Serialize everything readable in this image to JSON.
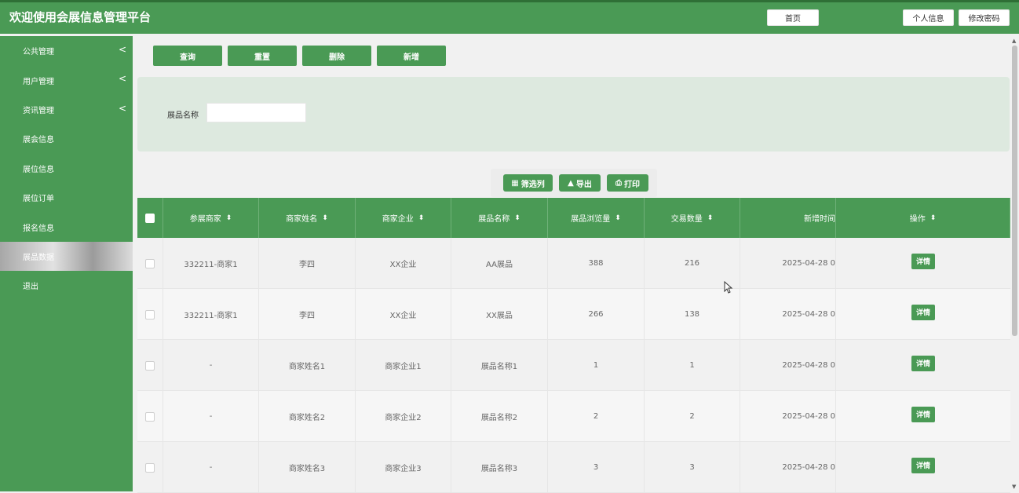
{
  "header": {
    "title": "欢迎使用会展信息管理平台",
    "home_label": "首页",
    "profile_label": "个人信息",
    "password_label": "修改密码"
  },
  "sidebar": {
    "items": [
      {
        "label": "公共管理",
        "has_submenu": true
      },
      {
        "label": "用户管理",
        "has_submenu": true
      },
      {
        "label": "资讯管理",
        "has_submenu": true
      },
      {
        "label": "展会信息",
        "has_submenu": false
      },
      {
        "label": "展位信息",
        "has_submenu": false
      },
      {
        "label": "展位订单",
        "has_submenu": false
      },
      {
        "label": "报名信息",
        "has_submenu": false
      },
      {
        "label": "展品数据",
        "has_submenu": false,
        "active": true
      },
      {
        "label": "退出",
        "has_submenu": false
      }
    ],
    "chevron": "<"
  },
  "actions": {
    "query": "查询",
    "reset": "重置",
    "delete": "删除",
    "add": "新增"
  },
  "search": {
    "label": "展品名称",
    "value": "",
    "placeholder": ""
  },
  "tools": {
    "filter_columns": "筛选列",
    "export": "导出",
    "print": "打印"
  },
  "table": {
    "columns": [
      "参展商家",
      "商家姓名",
      "商家企业",
      "展品名称",
      "展品浏览量",
      "交易数量",
      "新增时间",
      "操作"
    ],
    "detail_label": "详情",
    "rows": [
      [
        "332211-商家1",
        "李四",
        "XX企业",
        "AA展品",
        "388",
        "216",
        "2025-04-28 0"
      ],
      [
        "332211-商家1",
        "李四",
        "XX企业",
        "XX展品",
        "266",
        "138",
        "2025-04-28 0"
      ],
      [
        "-",
        "商家姓名1",
        "商家企业1",
        "展品名称1",
        "1",
        "1",
        "2025-04-28 0"
      ],
      [
        "-",
        "商家姓名2",
        "商家企业2",
        "展品名称2",
        "2",
        "2",
        "2025-04-28 0"
      ],
      [
        "-",
        "商家姓名3",
        "商家企业3",
        "展品名称3",
        "3",
        "3",
        "2025-04-28 0"
      ]
    ]
  },
  "colors": {
    "primary": "#4a9a55",
    "panel": "#dde9df"
  }
}
